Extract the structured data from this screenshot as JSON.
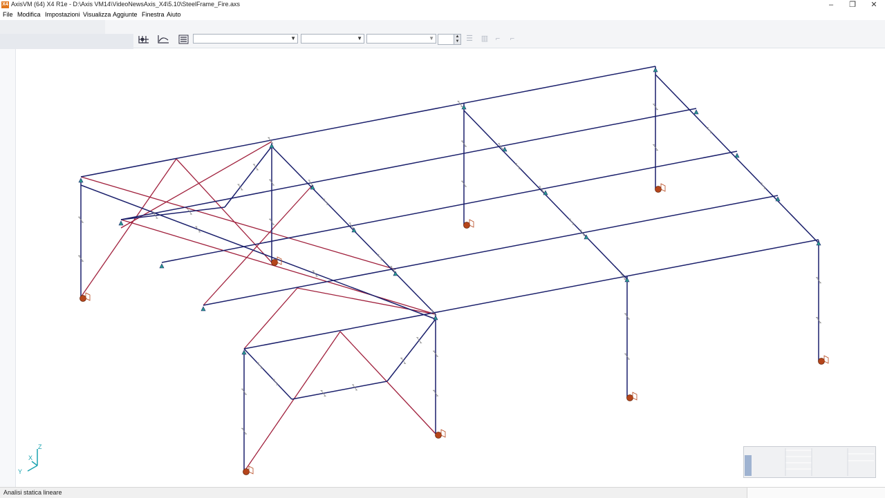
{
  "window": {
    "app_icon": "X4",
    "title": "AxisVM (64) X4 R1e - D:\\Axis VM14\\VideoNewsAxis_X4\\5.10\\SteelFrame_Fire.axs",
    "minimize": "–",
    "restore": "❐",
    "close": "✕"
  },
  "menu": {
    "items": [
      "File",
      "Modifica",
      "Impostazioni",
      "Visualizza",
      "Aggiunte",
      "Finestra",
      "Aiuto"
    ]
  },
  "toolbar": {
    "icons": [
      "node-grid-icon",
      "diagram-curve-icon",
      "list-settings-icon"
    ],
    "select1_value": "",
    "select2_value": "",
    "select3_value": "",
    "spinner_value": "",
    "disabled_icons": [
      "align-icon",
      "columns-icon",
      "step-back-icon",
      "step-forward-icon"
    ]
  },
  "axes": {
    "z": "Z",
    "x": "X",
    "y": "Y"
  },
  "colors": {
    "frame": "#1a1f6b",
    "bracing": "#a0203c",
    "support": "#2a9d8f",
    "fixed_base": "#b5451b"
  },
  "status": {
    "text": "Analisi statica lineare"
  }
}
